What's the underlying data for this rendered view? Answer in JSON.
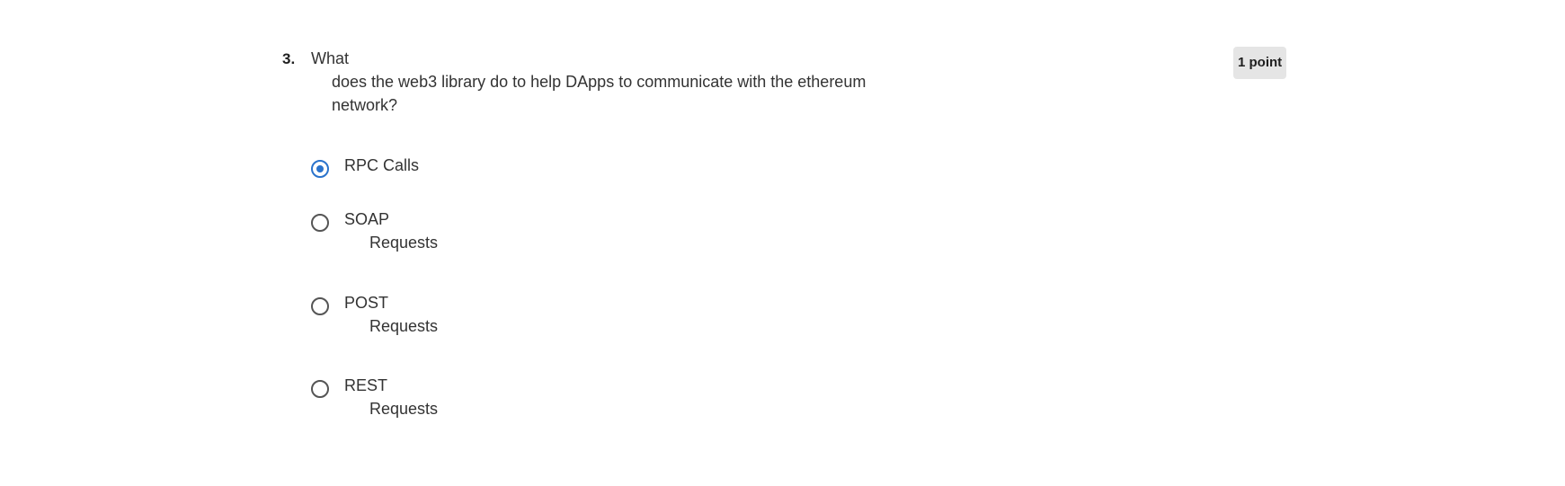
{
  "question": {
    "number": "3.",
    "text_line1": "What",
    "text_line2": "does the web3 library do to help DApps to communicate with the ethereum",
    "text_line3": "network?",
    "points": "1 point"
  },
  "options": [
    {
      "line1": "RPC Calls",
      "line2": "",
      "selected": true
    },
    {
      "line1": "SOAP",
      "line2": "Requests",
      "selected": false
    },
    {
      "line1": "POST",
      "line2": "Requests",
      "selected": false
    },
    {
      "line1": "REST",
      "line2": "Requests",
      "selected": false
    }
  ],
  "colors": {
    "accent": "#2a73cc",
    "badge_bg": "#e5e5e5",
    "text": "#333333"
  },
  "icons": {
    "radio_selected": "radio-checked-icon",
    "radio_unselected": "radio-unchecked-icon"
  }
}
